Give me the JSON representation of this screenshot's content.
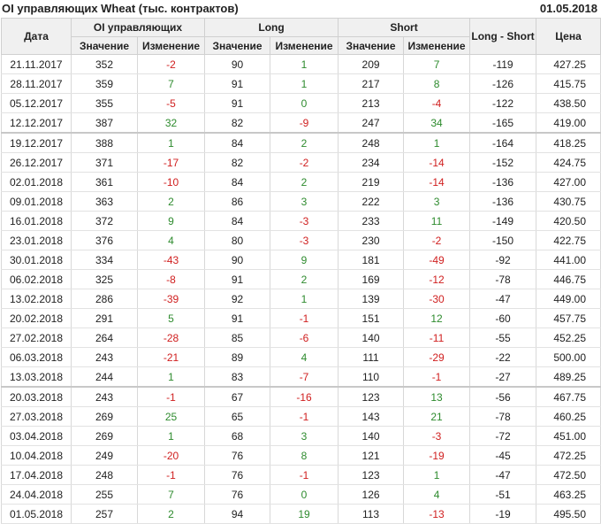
{
  "header": {
    "title": "OI управляющих Wheat (тыс. контрактов)",
    "date": "01.05.2018"
  },
  "columns": {
    "date": "Дата",
    "oi": "OI управляющих",
    "long": "Long",
    "short": "Short",
    "ls": "Long - Short",
    "price": "Цена",
    "value": "Значение",
    "change": "Изменение"
  },
  "colors": {
    "positive": "#2e8b2e",
    "negative": "#d02020"
  },
  "rows": [
    {
      "date": "21.11.2017",
      "oi": "352",
      "oi_chg": "-2",
      "long": "90",
      "long_chg": "1",
      "short": "209",
      "short_chg": "7",
      "ls": "-119",
      "price": "427.25",
      "grp": false
    },
    {
      "date": "28.11.2017",
      "oi": "359",
      "oi_chg": "7",
      "long": "91",
      "long_chg": "1",
      "short": "217",
      "short_chg": "8",
      "ls": "-126",
      "price": "415.75",
      "grp": false
    },
    {
      "date": "05.12.2017",
      "oi": "355",
      "oi_chg": "-5",
      "long": "91",
      "long_chg": "0",
      "short": "213",
      "short_chg": "-4",
      "ls": "-122",
      "price": "438.50",
      "grp": false
    },
    {
      "date": "12.12.2017",
      "oi": "387",
      "oi_chg": "32",
      "long": "82",
      "long_chg": "-9",
      "short": "247",
      "short_chg": "34",
      "ls": "-165",
      "price": "419.00",
      "grp": false
    },
    {
      "date": "19.12.2017",
      "oi": "388",
      "oi_chg": "1",
      "long": "84",
      "long_chg": "2",
      "short": "248",
      "short_chg": "1",
      "ls": "-164",
      "price": "418.25",
      "grp": true
    },
    {
      "date": "26.12.2017",
      "oi": "371",
      "oi_chg": "-17",
      "long": "82",
      "long_chg": "-2",
      "short": "234",
      "short_chg": "-14",
      "ls": "-152",
      "price": "424.75",
      "grp": false
    },
    {
      "date": "02.01.2018",
      "oi": "361",
      "oi_chg": "-10",
      "long": "84",
      "long_chg": "2",
      "short": "219",
      "short_chg": "-14",
      "ls": "-136",
      "price": "427.00",
      "grp": false
    },
    {
      "date": "09.01.2018",
      "oi": "363",
      "oi_chg": "2",
      "long": "86",
      "long_chg": "3",
      "short": "222",
      "short_chg": "3",
      "ls": "-136",
      "price": "430.75",
      "grp": false
    },
    {
      "date": "16.01.2018",
      "oi": "372",
      "oi_chg": "9",
      "long": "84",
      "long_chg": "-3",
      "short": "233",
      "short_chg": "11",
      "ls": "-149",
      "price": "420.50",
      "grp": false
    },
    {
      "date": "23.01.2018",
      "oi": "376",
      "oi_chg": "4",
      "long": "80",
      "long_chg": "-3",
      "short": "230",
      "short_chg": "-2",
      "ls": "-150",
      "price": "422.75",
      "grp": false
    },
    {
      "date": "30.01.2018",
      "oi": "334",
      "oi_chg": "-43",
      "long": "90",
      "long_chg": "9",
      "short": "181",
      "short_chg": "-49",
      "ls": "-92",
      "price": "441.00",
      "grp": false
    },
    {
      "date": "06.02.2018",
      "oi": "325",
      "oi_chg": "-8",
      "long": "91",
      "long_chg": "2",
      "short": "169",
      "short_chg": "-12",
      "ls": "-78",
      "price": "446.75",
      "grp": false
    },
    {
      "date": "13.02.2018",
      "oi": "286",
      "oi_chg": "-39",
      "long": "92",
      "long_chg": "1",
      "short": "139",
      "short_chg": "-30",
      "ls": "-47",
      "price": "449.00",
      "grp": false
    },
    {
      "date": "20.02.2018",
      "oi": "291",
      "oi_chg": "5",
      "long": "91",
      "long_chg": "-1",
      "short": "151",
      "short_chg": "12",
      "ls": "-60",
      "price": "457.75",
      "grp": false
    },
    {
      "date": "27.02.2018",
      "oi": "264",
      "oi_chg": "-28",
      "long": "85",
      "long_chg": "-6",
      "short": "140",
      "short_chg": "-11",
      "ls": "-55",
      "price": "452.25",
      "grp": false
    },
    {
      "date": "06.03.2018",
      "oi": "243",
      "oi_chg": "-21",
      "long": "89",
      "long_chg": "4",
      "short": "111",
      "short_chg": "-29",
      "ls": "-22",
      "price": "500.00",
      "grp": false
    },
    {
      "date": "13.03.2018",
      "oi": "244",
      "oi_chg": "1",
      "long": "83",
      "long_chg": "-7",
      "short": "110",
      "short_chg": "-1",
      "ls": "-27",
      "price": "489.25",
      "grp": false
    },
    {
      "date": "20.03.2018",
      "oi": "243",
      "oi_chg": "-1",
      "long": "67",
      "long_chg": "-16",
      "short": "123",
      "short_chg": "13",
      "ls": "-56",
      "price": "467.75",
      "grp": true
    },
    {
      "date": "27.03.2018",
      "oi": "269",
      "oi_chg": "25",
      "long": "65",
      "long_chg": "-1",
      "short": "143",
      "short_chg": "21",
      "ls": "-78",
      "price": "460.25",
      "grp": false
    },
    {
      "date": "03.04.2018",
      "oi": "269",
      "oi_chg": "1",
      "long": "68",
      "long_chg": "3",
      "short": "140",
      "short_chg": "-3",
      "ls": "-72",
      "price": "451.00",
      "grp": false
    },
    {
      "date": "10.04.2018",
      "oi": "249",
      "oi_chg": "-20",
      "long": "76",
      "long_chg": "8",
      "short": "121",
      "short_chg": "-19",
      "ls": "-45",
      "price": "472.25",
      "grp": false
    },
    {
      "date": "17.04.2018",
      "oi": "248",
      "oi_chg": "-1",
      "long": "76",
      "long_chg": "-1",
      "short": "123",
      "short_chg": "1",
      "ls": "-47",
      "price": "472.50",
      "grp": false
    },
    {
      "date": "24.04.2018",
      "oi": "255",
      "oi_chg": "7",
      "long": "76",
      "long_chg": "0",
      "short": "126",
      "short_chg": "4",
      "ls": "-51",
      "price": "463.25",
      "grp": false
    },
    {
      "date": "01.05.2018",
      "oi": "257",
      "oi_chg": "2",
      "long": "94",
      "long_chg": "19",
      "short": "113",
      "short_chg": "-13",
      "ls": "-19",
      "price": "495.50",
      "grp": false
    }
  ]
}
